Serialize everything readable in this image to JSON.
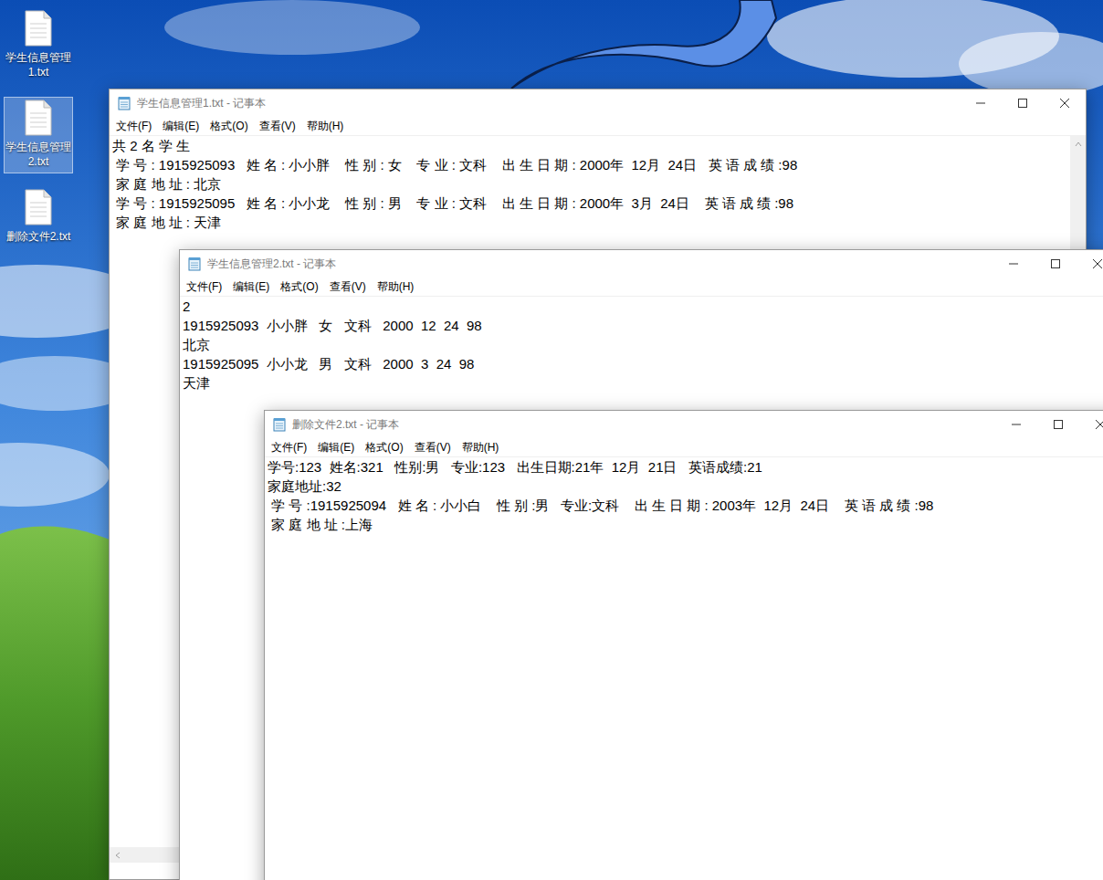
{
  "desktop_icons": [
    {
      "label_lines": [
        "学生信息管理",
        "1.txt"
      ],
      "selected": false
    },
    {
      "label_lines": [
        "学生信息管理",
        "2.txt"
      ],
      "selected": true
    },
    {
      "label_lines": [
        "删除文件2.txt"
      ],
      "selected": false
    }
  ],
  "windows": [
    {
      "title": "学生信息管理1.txt - 记事本",
      "active": false,
      "menu": [
        "文件(F)",
        "编辑(E)",
        "格式(O)",
        "查看(V)",
        "帮助(H)"
      ],
      "lines": [
        "共 2 名 学 生",
        " 学 号 : 1915925093   姓 名 : 小小胖    性 别 : 女    专 业 : 文科    出 生 日 期 : 2000年  12月  24日   英 语 成 绩 :98",
        " 家 庭 地 址 : 北京",
        " 学 号 : 1915925095   姓 名 : 小小龙    性 别 : 男    专 业 : 文科    出 生 日 期 : 2000年  3月  24日    英 语 成 绩 :98",
        " 家 庭 地 址 : 天津"
      ]
    },
    {
      "title": "学生信息管理2.txt - 记事本",
      "active": false,
      "menu": [
        "文件(F)",
        "编辑(E)",
        "格式(O)",
        "查看(V)",
        "帮助(H)"
      ],
      "lines": [
        "2",
        "1915925093  小小胖   女   文科   2000  12  24  98",
        "北京",
        "1915925095  小小龙   男   文科   2000  3  24  98",
        "天津"
      ]
    },
    {
      "title": "删除文件2.txt - 记事本",
      "active": false,
      "menu": [
        "文件(F)",
        "编辑(E)",
        "格式(O)",
        "查看(V)",
        "帮助(H)"
      ],
      "lines": [
        "学号:123  姓名:321   性别:男   专业:123   出生日期:21年  12月  21日   英语成绩:21",
        "家庭地址:32",
        " 学 号 :1915925094   姓 名 : 小小白    性 别 :男   专业:文科    出 生 日 期 : 2003年  12月  24日    英 语 成 绩 :98",
        " 家 庭 地 址 :上海"
      ]
    }
  ]
}
